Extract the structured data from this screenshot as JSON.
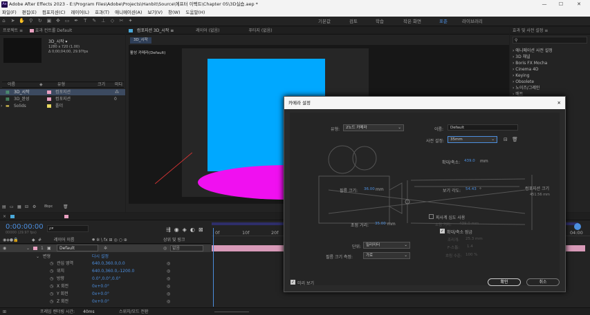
{
  "app": {
    "title": "Adobe After Effects 2023 - E:\\Program Files\\Adobe\\Projects\\Hanbit\\Source\\에프터 이펙트\\Chapter 05\\3D실습.aep *",
    "icon": "Ae",
    "window_controls": [
      "—",
      "☐",
      "✕"
    ]
  },
  "menu": [
    "파일(F)",
    "편집(E)",
    "컴포지션(C)",
    "레이어(L)",
    "효과(T)",
    "애니메이션(A)",
    "보기(V)",
    "창(W)",
    "도움말(H)"
  ],
  "workspaces": [
    "기본값",
    "검토",
    "학습",
    "작은 화면",
    "표준",
    "라이브러리"
  ],
  "active_workspace": "표준",
  "project": {
    "panel_title": "프로젝트 ≡",
    "panel_title2": "효과 컨트롤 Default",
    "comp_name": "3D_시작 ▾",
    "comp_info1": "1280 x 720 (1.00)",
    "comp_info2": "Δ 0;00;04;00, 29.97fps",
    "headers": [
      "이름",
      "유형",
      "크기",
      "미디"
    ],
    "items": [
      {
        "name": "3D_시작",
        "type": "컴포지션",
        "size": "",
        "color": "#e8a0c0",
        "selected": true
      },
      {
        "name": "3D_완성",
        "type": "컴포지션",
        "size": "0",
        "color": "#e8a0c0",
        "selected": false
      },
      {
        "name": "Solids",
        "type": "폴더",
        "size": "",
        "color": "#e8d860",
        "selected": false
      }
    ],
    "bpc": "8bpc"
  },
  "comp_viewer": {
    "tabs": [
      "컴포지션 3D_시작 ≡",
      "레이어 (없음)",
      "푸티지 (없음)"
    ],
    "breadcrumb": "3D_시작",
    "camera_label": "활성 카메라(Default)",
    "plane_color": "#00a8ff",
    "disc_color": "#f010f0"
  },
  "effects_panel": {
    "title": "효과 및 사전 설정 ≡",
    "items": [
      "› 애니메이션 사전 설정",
      "› 3D 채널",
      "› Boris FX Mocha",
      "› Cinema 4D",
      "› Keying",
      "› Obsolete",
      "› 노이즈/그레인",
      "› 매트"
    ]
  },
  "timeline": {
    "time": "0:00:00:00",
    "time_sub": "00000 (29.97 fps)",
    "search_placeholder": "ρ▾",
    "headers": {
      "layer_name": "레이어 이름",
      "switches": "🞿 ✲ \\ fx ⊞ ◎ ○ ⊕",
      "parent": "상위 및 링크"
    },
    "layer": {
      "num": "1",
      "name": "Default",
      "parent": "없음"
    },
    "transform_label": "변형",
    "reset_label": "다시 설정",
    "props": [
      {
        "name": "관심 영역",
        "value": "640.0,360.0,0.0"
      },
      {
        "name": "위치",
        "value": "640.0,360.0,-1200.0"
      },
      {
        "name": "방향",
        "value": "0.0°,0.0°,0.0°"
      },
      {
        "name": "X 회전",
        "value": "0x+0.0°"
      },
      {
        "name": "Y 회전",
        "value": "0x+0.0°"
      },
      {
        "name": "Z 회전",
        "value": "0x+0.0°"
      }
    ],
    "ruler": [
      "0f",
      "10f",
      "20f",
      "04:00"
    ],
    "footer_render": "프레임 렌더링 시간:",
    "footer_render_val": "40ms",
    "footer_switch": "스위치/모드 전환"
  },
  "camera_dialog": {
    "title": "카메라 설정",
    "type_label": "유형:",
    "type_value": "2노드 카메라",
    "name_label": "이름:",
    "name_value": "Default",
    "preset_label": "사전 설정:",
    "preset_value": "35mm",
    "zoom_label": "확대/축소:",
    "zoom_value": "439.0",
    "zoom_unit": "mm",
    "film_label": "필름 크기:",
    "film_value": "36.00",
    "film_unit": "mm",
    "angle_label": "보기 각도:",
    "angle_value": "54.43",
    "angle_unit": "°",
    "comp_size_label": "컴포지션 크기",
    "comp_size_value": "451.56 mm",
    "focal_label": "초점 거리:",
    "focal_value": "35.00",
    "focal_unit": "mm",
    "dof_label": "피사계 심도 사용",
    "focus_dist_label": "초점 거리:",
    "focus_dist_value": "439.0 mm",
    "zoom_lock_label": "확대/축소 잠금",
    "aperture_label": "조리개:",
    "aperture_value": "25.3 mm",
    "fstop_label": "F-스톱:",
    "fstop_value": "1.4",
    "blur_label": "흐림 수준:",
    "blur_value": "100 %",
    "units_label": "단위:",
    "units_value": "밀리미터",
    "measure_label": "필름 크기 측정:",
    "measure_value": "가로",
    "preview_label": "미리 보기",
    "ok_label": "확인",
    "cancel_label": "취소",
    "close": "✕"
  }
}
